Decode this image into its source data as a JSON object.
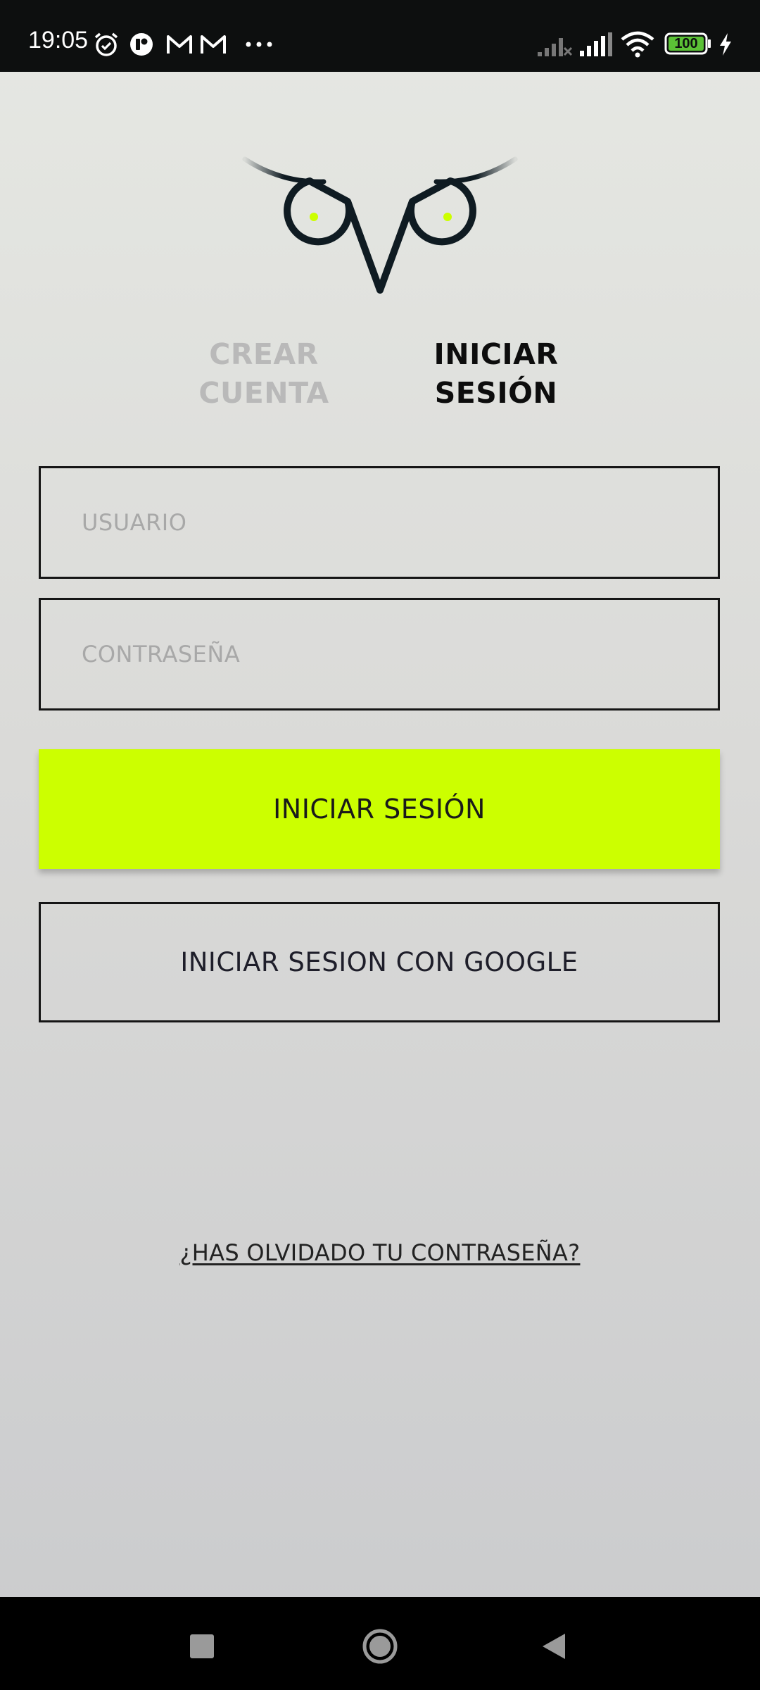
{
  "status_bar": {
    "time": "19:05",
    "battery": "100",
    "icons": [
      "alarm-icon",
      "app-notification-icon",
      "gmail-icon",
      "gmail-icon",
      "more-dots-icon",
      "signal-no-service-icon",
      "signal-icon",
      "wifi-icon",
      "battery-icon",
      "charging-icon"
    ]
  },
  "tabs": {
    "create_account": "CREAR\nCUENTA",
    "login": "INICIAR\nSESIÓN",
    "active": "login"
  },
  "form": {
    "username_placeholder": "USUARIO",
    "password_placeholder": "CONTRASEÑA"
  },
  "buttons": {
    "login": "INICIAR SESIÓN",
    "google": "INICIAR SESION CON GOOGLE"
  },
  "forgot_password": "¿HAS OLVIDADO TU CONTRASEÑA?",
  "colors": {
    "accent": "#ccff00",
    "logo": "#0f1b22",
    "text_dark": "#0d0d0d",
    "tab_inactive": "#b9b9b9"
  },
  "nav_bar": {
    "icons": [
      "recents-square-icon",
      "home-circle-icon",
      "back-triangle-icon"
    ]
  }
}
